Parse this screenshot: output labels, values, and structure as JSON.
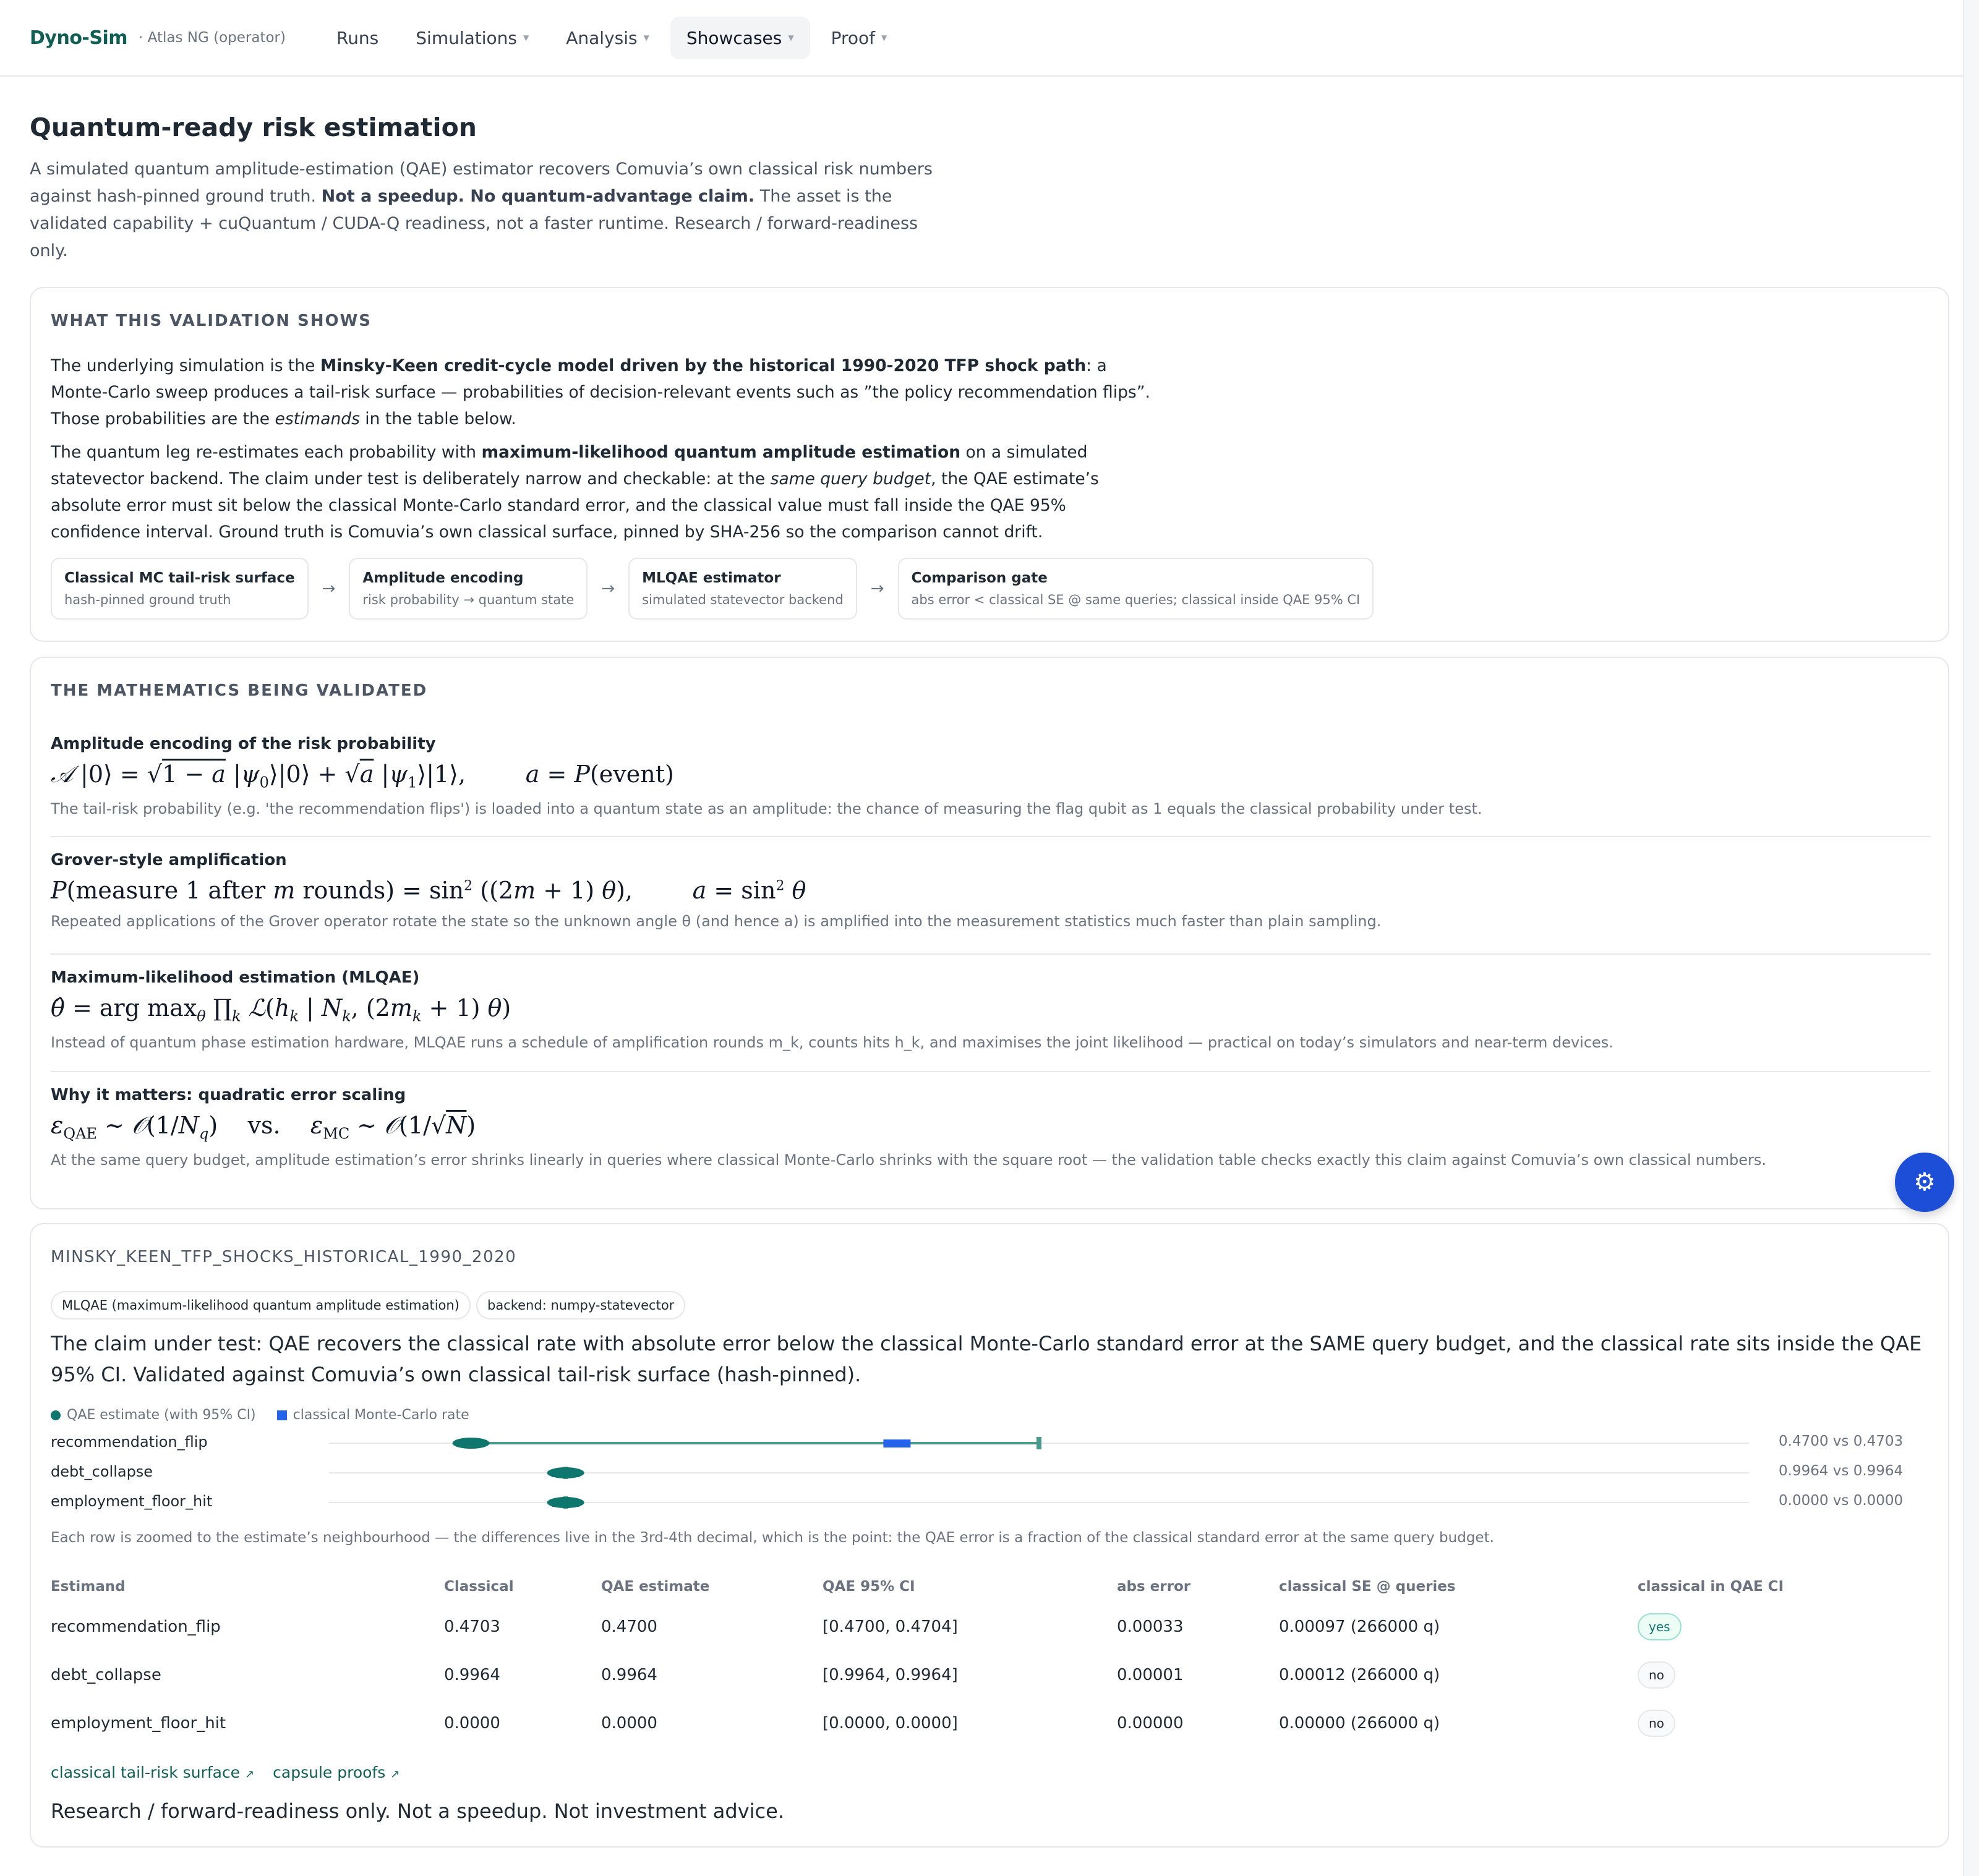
{
  "nav": {
    "brand": "Dyno-Sim",
    "operator": "· Atlas NG (operator)",
    "items": [
      {
        "label": "Runs",
        "caret": false,
        "active": false
      },
      {
        "label": "Simulations",
        "caret": true,
        "active": false
      },
      {
        "label": "Analysis",
        "caret": true,
        "active": false
      },
      {
        "label": "Showcases",
        "caret": true,
        "active": true
      },
      {
        "label": "Proof",
        "caret": true,
        "active": false
      }
    ]
  },
  "hero": {
    "title": "Quantum-ready risk estimation",
    "intro_1": "A simulated quantum amplitude-estimation (QAE) estimator recovers Comuvia’s own classical risk numbers against hash-pinned ground truth. ",
    "intro_bold": "Not a speedup. No quantum-advantage claim.",
    "intro_2": " The asset is the validated capability + cuQuantum / CUDA-Q readiness, not a faster runtime. Research / forward-readiness only."
  },
  "what": {
    "heading": "WHAT THIS VALIDATION SHOWS",
    "p1_a": "The underlying simulation is the ",
    "p1_bold": "Minsky-Keen credit-cycle model driven by the historical 1990-2020 TFP shock path",
    "p1_b": ": a Monte-Carlo sweep produces a tail-risk surface — probabilities of decision-relevant events such as ”the policy recommendation flips”. Those probabilities are the ",
    "p1_italic": "estimands",
    "p1_c": " in the table below.",
    "p2_a": "The quantum leg re-estimates each probability with ",
    "p2_bold": "maximum-likelihood quantum amplitude estimation",
    "p2_b": " on a simulated statevector backend. The claim under test is deliberately narrow and checkable: at the ",
    "p2_italic": "same query budget",
    "p2_c": ", the QAE estimate’s absolute error must sit below the classical Monte-Carlo standard error, and the classical value must fall inside the QAE 95% confidence interval. Ground truth is Comuvia’s own classical surface, pinned by SHA-256 so the comparison cannot drift.",
    "pipeline": [
      {
        "title": "Classical MC tail-risk surface",
        "sub": "hash-pinned ground truth"
      },
      {
        "title": "Amplitude encoding",
        "sub": "risk probability → quantum state"
      },
      {
        "title": "MLQAE estimator",
        "sub": "simulated statevector backend"
      },
      {
        "title": "Comparison gate",
        "sub": "abs error < classical SE @ same queries; classical inside QAE 95% CI"
      }
    ],
    "arrow": "→"
  },
  "math": {
    "heading": "THE MATHEMATICS BEING VALIDATED",
    "blocks": [
      {
        "title": "Amplitude encoding of the risk probability",
        "desc": "The tail-risk probability (e.g. 'the recommendation flips') is loaded into a quantum state as an amplitude: the chance of measuring the flag qubit as 1 equals the classical probability under test."
      },
      {
        "title": "Grover-style amplification",
        "desc": "Repeated applications of the Grover operator rotate the state so the unknown angle θ (and hence a) is amplified into the measurement statistics much faster than plain sampling."
      },
      {
        "title": "Maximum-likelihood estimation (MLQAE)",
        "desc": "Instead of quantum phase estimation hardware, MLQAE runs a schedule of amplification rounds m_k, counts hits h_k, and maximises the joint likelihood — practical on today’s simulators and near-term devices."
      },
      {
        "title": "Why it matters: quadratic error scaling",
        "desc": "At the same query budget, amplitude estimation’s error shrinks linearly in queries where classical Monte-Carlo shrinks with the square root — the validation table checks exactly this claim against Comuvia’s own classical numbers."
      }
    ]
  },
  "dataset": {
    "heading": "MINSKY_KEEN_TFP_SHOCKS_HISTORICAL_1990_2020",
    "pills": [
      "MLQAE (maximum-likelihood quantum amplitude estimation)",
      "backend: numpy-statevector"
    ],
    "claim": "The claim under test: QAE recovers the classical rate with absolute error below the classical Monte-Carlo standard error at the SAME query budget, and the classical rate sits inside the QAE 95% CI. Validated against Comuvia’s own classical tail-risk surface (hash-pinned).",
    "legend": {
      "qae": "QAE estimate (with 95% CI)",
      "classical": "classical Monte-Carlo rate"
    },
    "colors": {
      "qae": "#0f766e",
      "classical": "#2563eb",
      "ci": "#4a9a8c"
    },
    "dot_rows": [
      {
        "label": "recommendation_flip",
        "value_text": "0.4700 vs 0.4703",
        "qae": 0.47,
        "ci_low": 0.47,
        "ci_high": 0.4704,
        "classical": 0.4703
      },
      {
        "label": "debt_collapse",
        "value_text": "0.9964 vs 0.9964",
        "qae": 0.9964,
        "ci_low": 0.9964,
        "ci_high": 0.9964,
        "classical": 0.9964
      },
      {
        "label": "employment_floor_hit",
        "value_text": "0.0000 vs 0.0000",
        "qae": 0.0,
        "ci_low": 0.0,
        "ci_high": 0.0,
        "classical": 0.0
      }
    ],
    "zoom_note": "Each row is zoomed to the estimate’s neighbourhood — the differences live in the 3rd-4th decimal, which is the point: the QAE error is a fraction of the classical standard error at the same query budget.",
    "table": {
      "columns": [
        "Estimand",
        "Classical",
        "QAE estimate",
        "QAE 95% CI",
        "abs error",
        "classical SE @ queries",
        "classical in QAE CI"
      ],
      "rows": [
        {
          "estimand": "recommendation_flip",
          "classical": "0.4703",
          "qae": "0.4700",
          "ci": "[0.4700, 0.4704]",
          "abs_error": "0.00033",
          "se": "0.00097 (266000 q)",
          "in_ci": "yes"
        },
        {
          "estimand": "debt_collapse",
          "classical": "0.9964",
          "qae": "0.9964",
          "ci": "[0.9964, 0.9964]",
          "abs_error": "0.00001",
          "se": "0.00012 (266000 q)",
          "in_ci": "no"
        },
        {
          "estimand": "employment_floor_hit",
          "classical": "0.0000",
          "qae": "0.0000",
          "ci": "[0.0000, 0.0000]",
          "abs_error": "0.00000",
          "se": "0.00000 (266000 q)",
          "in_ci": "no"
        }
      ]
    },
    "links": [
      "classical tail-risk surface",
      "capsule proofs"
    ],
    "link_icon": "external-link-icon",
    "disclaimer": "Research / forward-readiness only. Not a speedup. Not investment advice."
  },
  "fab": {
    "icon": "gear-icon"
  }
}
